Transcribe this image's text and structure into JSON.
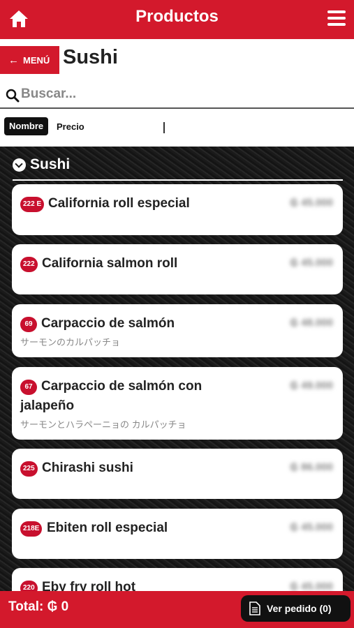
{
  "header": {
    "title": "Productos"
  },
  "back_button": {
    "label": "MENÚ"
  },
  "section_title": "Sushi",
  "search": {
    "placeholder": "Buscar..."
  },
  "sort": {
    "active": "Nombre",
    "other": "Precio"
  },
  "category": {
    "title": "Sushi"
  },
  "products": [
    {
      "code": "222 E",
      "name": "California roll especial",
      "subtitle": "",
      "price": "₲ 45.000"
    },
    {
      "code": "222",
      "name": "California salmon roll",
      "subtitle": "",
      "price": "₲ 45.000"
    },
    {
      "code": "69",
      "name": "Carpaccio de salmón",
      "subtitle": "サーモンのカルパッチョ",
      "price": "₲ 48.000"
    },
    {
      "code": "67",
      "name": "Carpaccio de salmón con jalapeño",
      "subtitle": "サーモンとハラペーニョの カルパッチョ",
      "price": "₲ 49.000"
    },
    {
      "code": "225",
      "name": "Chirashi sushi",
      "subtitle": "",
      "price": "₲ 86.000"
    },
    {
      "code": "218E",
      "name": "Ebiten roll especial",
      "subtitle": "",
      "price": "₲ 45.000"
    },
    {
      "code": "220",
      "name": "Eby fry roll hot",
      "subtitle": "",
      "price": "₲ 45.000"
    }
  ],
  "footer": {
    "total": "Total: ₲ 0",
    "order_button": "Ver pedido (0)"
  },
  "colors": {
    "brand": "#d3192c",
    "code_badge": "#c8102e",
    "dark": "#111111"
  }
}
